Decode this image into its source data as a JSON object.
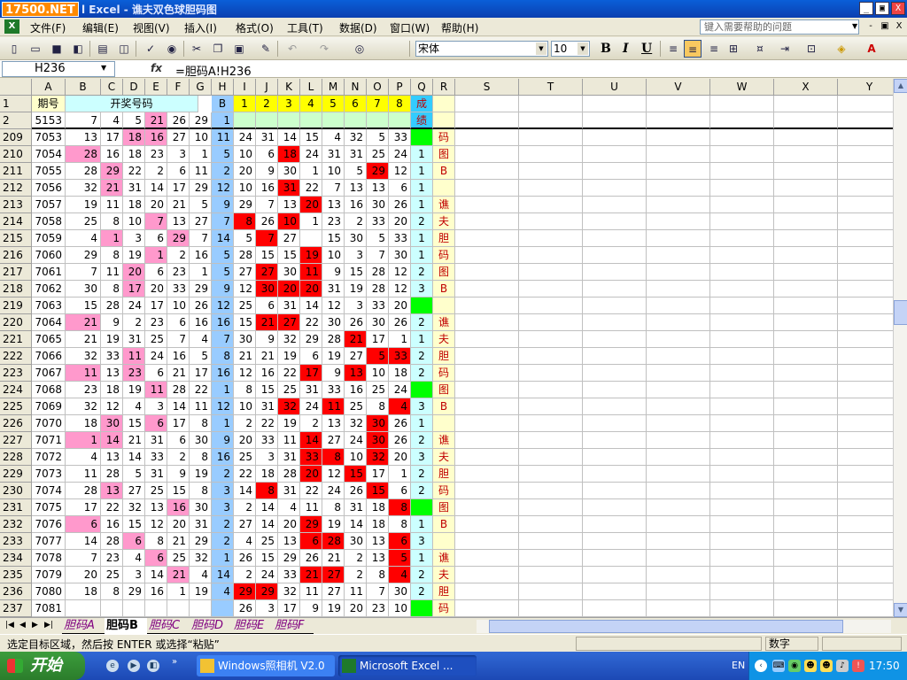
{
  "titlebar": {
    "logo": "17500.NET",
    "title": "l Excel - 谯夫双色球胆码图",
    "min": "_",
    "restore": "▣",
    "close": "X"
  },
  "menubar": {
    "items": [
      "文件(F)",
      "编辑(E)",
      "视图(V)",
      "插入(I)",
      "格式(O)",
      "工具(T)",
      "数据(D)",
      "窗口(W)",
      "帮助(H)"
    ],
    "help_placeholder": "键入需要帮助的问题",
    "doc_min": "-",
    "doc_restore": "▣",
    "doc_close": "X"
  },
  "toolbar": {
    "font": "宋体",
    "size": "10",
    "bold": "B",
    "italic": "I",
    "underline": "U"
  },
  "formula_bar": {
    "cell_ref": "H236",
    "fx": "fx",
    "formula": "=胆码A!H236"
  },
  "columns": [
    "A",
    "B",
    "C",
    "D",
    "E",
    "F",
    "G",
    "H",
    "I",
    "J",
    "K",
    "L",
    "M",
    "N",
    "O",
    "P",
    "Q",
    "R",
    "S",
    "T",
    "U",
    "V",
    "W",
    "X",
    "Y"
  ],
  "header_rows": {
    "row1": {
      "num": "1",
      "period": "期号",
      "draw": "开奖号码",
      "blue": "B",
      "pos": [
        "1",
        "2",
        "3",
        "4",
        "5",
        "6",
        "7",
        "8"
      ],
      "result": "成"
    },
    "row2": {
      "num": "2",
      "a": "5153",
      "b": "7",
      "c": "4",
      "d": "5",
      "e": "21",
      "f": "26",
      "g": "29",
      "h": "1",
      "result": "绩"
    }
  },
  "rows": [
    {
      "n": "209",
      "a": "7053",
      "d": [
        13,
        17,
        18,
        16,
        27,
        10
      ],
      "h": 11,
      "p": [
        24,
        31,
        14,
        15,
        4,
        32,
        5,
        33
      ],
      "q": "",
      "r": "码"
    },
    {
      "n": "210",
      "a": "7054",
      "d": [
        28,
        16,
        18,
        23,
        3,
        1
      ],
      "h": 5,
      "p": [
        10,
        6,
        18,
        24,
        31,
        31,
        25,
        24
      ],
      "q": "1",
      "r": "图"
    },
    {
      "n": "211",
      "a": "7055",
      "d": [
        28,
        29,
        22,
        2,
        6,
        11
      ],
      "h": 2,
      "p": [
        20,
        9,
        30,
        1,
        10,
        5,
        29,
        12
      ],
      "q": "1",
      "r": "B"
    },
    {
      "n": "212",
      "a": "7056",
      "d": [
        32,
        21,
        31,
        14,
        17,
        29
      ],
      "h": 12,
      "p": [
        10,
        16,
        31,
        22,
        7,
        13,
        13,
        6
      ],
      "q": "1",
      "r": ""
    },
    {
      "n": "213",
      "a": "7057",
      "d": [
        19,
        11,
        18,
        20,
        21,
        5
      ],
      "h": 9,
      "p": [
        29,
        7,
        13,
        20,
        13,
        16,
        30,
        26
      ],
      "q": "1",
      "r": "谯"
    },
    {
      "n": "214",
      "a": "7058",
      "d": [
        25,
        8,
        10,
        7,
        13,
        27
      ],
      "h": 7,
      "p": [
        8,
        26,
        10,
        1,
        23,
        2,
        33,
        20
      ],
      "q": "2",
      "r": "夫"
    },
    {
      "n": "215",
      "a": "7059",
      "d": [
        4,
        1,
        3,
        6,
        29,
        7
      ],
      "h": 14,
      "p": [
        5,
        7,
        27,
        "",
        15,
        30,
        5,
        33
      ],
      "q": "1",
      "r": "胆"
    },
    {
      "n": "216",
      "a": "7060",
      "d": [
        29,
        8,
        19,
        1,
        2,
        16
      ],
      "h": 5,
      "p": [
        28,
        15,
        15,
        19,
        10,
        3,
        7,
        30
      ],
      "q": "1",
      "r": "码"
    },
    {
      "n": "217",
      "a": "7061",
      "d": [
        7,
        11,
        20,
        6,
        23,
        1
      ],
      "h": 5,
      "p": [
        27,
        27,
        30,
        11,
        9,
        15,
        28,
        12
      ],
      "q": "2",
      "r": "图"
    },
    {
      "n": "218",
      "a": "7062",
      "d": [
        30,
        8,
        17,
        20,
        33,
        29
      ],
      "h": 9,
      "p": [
        12,
        30,
        20,
        20,
        31,
        19,
        28,
        12
      ],
      "q": "3",
      "r": "B"
    },
    {
      "n": "219",
      "a": "7063",
      "d": [
        15,
        28,
        24,
        17,
        10,
        26
      ],
      "h": 12,
      "p": [
        25,
        6,
        31,
        14,
        12,
        3,
        33,
        20
      ],
      "q": "",
      "r": ""
    },
    {
      "n": "220",
      "a": "7064",
      "d": [
        21,
        9,
        2,
        23,
        6,
        16
      ],
      "h": 16,
      "p": [
        15,
        21,
        27,
        22,
        30,
        26,
        30,
        26
      ],
      "q": "2",
      "r": "谯"
    },
    {
      "n": "221",
      "a": "7065",
      "d": [
        21,
        19,
        31,
        25,
        7,
        4
      ],
      "h": 7,
      "p": [
        30,
        9,
        32,
        29,
        28,
        21,
        17,
        1
      ],
      "q": "1",
      "r": "夫"
    },
    {
      "n": "222",
      "a": "7066",
      "d": [
        32,
        33,
        11,
        24,
        16,
        5
      ],
      "h": 8,
      "p": [
        21,
        21,
        19,
        6,
        19,
        27,
        5,
        33
      ],
      "q": "2",
      "r": "胆"
    },
    {
      "n": "223",
      "a": "7067",
      "d": [
        11,
        13,
        23,
        6,
        21,
        17
      ],
      "h": 16,
      "p": [
        12,
        16,
        22,
        17,
        9,
        13,
        10,
        18
      ],
      "q": "2",
      "r": "码"
    },
    {
      "n": "224",
      "a": "7068",
      "d": [
        23,
        18,
        19,
        11,
        28,
        22
      ],
      "h": 1,
      "p": [
        8,
        15,
        25,
        31,
        33,
        16,
        25,
        24
      ],
      "q": "",
      "r": "图"
    },
    {
      "n": "225",
      "a": "7069",
      "d": [
        32,
        12,
        4,
        3,
        14,
        11
      ],
      "h": 12,
      "p": [
        10,
        31,
        32,
        24,
        11,
        25,
        8,
        4
      ],
      "q": "3",
      "r": "B"
    },
    {
      "n": "226",
      "a": "7070",
      "d": [
        18,
        30,
        15,
        6,
        17,
        8
      ],
      "h": 1,
      "p": [
        2,
        22,
        19,
        2,
        13,
        32,
        30,
        26
      ],
      "q": "1",
      "r": ""
    },
    {
      "n": "227",
      "a": "7071",
      "d": [
        1,
        14,
        21,
        31,
        6,
        30
      ],
      "h": 9,
      "p": [
        20,
        33,
        11,
        14,
        27,
        24,
        30,
        26
      ],
      "q": "2",
      "r": "谯"
    },
    {
      "n": "228",
      "a": "7072",
      "d": [
        4,
        13,
        14,
        33,
        2,
        8
      ],
      "h": 16,
      "p": [
        25,
        3,
        31,
        33,
        8,
        10,
        32,
        20
      ],
      "q": "3",
      "r": "夫"
    },
    {
      "n": "229",
      "a": "7073",
      "d": [
        11,
        28,
        5,
        31,
        9,
        19
      ],
      "h": 2,
      "p": [
        22,
        18,
        28,
        20,
        12,
        15,
        17,
        1
      ],
      "q": "2",
      "r": "胆"
    },
    {
      "n": "230",
      "a": "7074",
      "d": [
        28,
        13,
        27,
        25,
        15,
        8
      ],
      "h": 3,
      "p": [
        14,
        8,
        31,
        22,
        24,
        26,
        15,
        6
      ],
      "q": "2",
      "r": "码"
    },
    {
      "n": "231",
      "a": "7075",
      "d": [
        17,
        22,
        32,
        13,
        16,
        30
      ],
      "h": 3,
      "p": [
        2,
        14,
        4,
        11,
        8,
        31,
        18,
        8
      ],
      "q": "",
      "r": "图"
    },
    {
      "n": "232",
      "a": "7076",
      "d": [
        6,
        16,
        15,
        12,
        20,
        31
      ],
      "h": 2,
      "p": [
        27,
        14,
        20,
        29,
        19,
        14,
        18,
        8
      ],
      "q": "1",
      "r": "B"
    },
    {
      "n": "233",
      "a": "7077",
      "d": [
        14,
        28,
        6,
        8,
        21,
        29
      ],
      "h": 2,
      "p": [
        4,
        25,
        13,
        6,
        28,
        30,
        13,
        6
      ],
      "q": "3",
      "r": ""
    },
    {
      "n": "234",
      "a": "7078",
      "d": [
        7,
        23,
        4,
        6,
        25,
        32
      ],
      "h": 1,
      "p": [
        26,
        15,
        29,
        26,
        21,
        2,
        13,
        5
      ],
      "q": "1",
      "r": "谯"
    },
    {
      "n": "235",
      "a": "7079",
      "d": [
        20,
        25,
        3,
        14,
        21,
        4
      ],
      "h": 14,
      "p": [
        2,
        24,
        33,
        21,
        27,
        2,
        8,
        4
      ],
      "q": "2",
      "r": "夫"
    },
    {
      "n": "236",
      "a": "7080",
      "d": [
        18,
        8,
        29,
        16,
        1,
        19
      ],
      "h": 4,
      "p": [
        29,
        29,
        32,
        11,
        27,
        11,
        7,
        30
      ],
      "q": "2",
      "r": "胆"
    },
    {
      "n": "237",
      "a": "7081",
      "d": [
        "",
        "",
        "",
        "",
        "",
        ""
      ],
      "h": "",
      "p": [
        26,
        3,
        17,
        9,
        19,
        20,
        23,
        10
      ],
      "q": "",
      "r": "码"
    }
  ],
  "pink_cells": [
    [
      0,
      2
    ],
    [
      0,
      3
    ],
    [
      1,
      0
    ],
    [
      2,
      1
    ],
    [
      3,
      1
    ],
    [
      5,
      3
    ],
    [
      6,
      1
    ],
    [
      6,
      4
    ],
    [
      7,
      3
    ],
    [
      8,
      2
    ],
    [
      9,
      2
    ],
    [
      11,
      0
    ],
    [
      13,
      2
    ],
    [
      14,
      0
    ],
    [
      14,
      2
    ],
    [
      15,
      3
    ],
    [
      17,
      1
    ],
    [
      17,
      3
    ],
    [
      18,
      0
    ],
    [
      18,
      1
    ],
    [
      21,
      1
    ],
    [
      22,
      4
    ],
    [
      23,
      0
    ],
    [
      24,
      2
    ],
    [
      25,
      3
    ],
    [
      26,
      4
    ]
  ],
  "red_cells": [
    [
      1,
      2
    ],
    [
      2,
      6
    ],
    [
      3,
      2
    ],
    [
      4,
      3
    ],
    [
      5,
      0
    ],
    [
      5,
      2
    ],
    [
      6,
      1
    ],
    [
      7,
      3
    ],
    [
      8,
      1
    ],
    [
      8,
      3
    ],
    [
      9,
      1
    ],
    [
      9,
      2
    ],
    [
      9,
      3
    ],
    [
      11,
      1
    ],
    [
      11,
      2
    ],
    [
      12,
      5
    ],
    [
      13,
      6
    ],
    [
      13,
      7
    ],
    [
      14,
      3
    ],
    [
      14,
      5
    ],
    [
      16,
      2
    ],
    [
      16,
      4
    ],
    [
      16,
      7
    ],
    [
      17,
      6
    ],
    [
      18,
      3
    ],
    [
      18,
      6
    ],
    [
      19,
      3
    ],
    [
      19,
      4
    ],
    [
      19,
      6
    ],
    [
      20,
      3
    ],
    [
      20,
      5
    ],
    [
      21,
      1
    ],
    [
      21,
      6
    ],
    [
      22,
      7
    ],
    [
      23,
      3
    ],
    [
      24,
      3
    ],
    [
      24,
      4
    ],
    [
      24,
      7
    ],
    [
      25,
      7
    ],
    [
      26,
      3
    ],
    [
      26,
      4
    ],
    [
      26,
      7
    ],
    [
      27,
      0
    ],
    [
      27,
      1
    ]
  ],
  "sheet_tabs": [
    "胆码A",
    "胆码B",
    "胆码C",
    "胆码D",
    "胆码E",
    "胆码F"
  ],
  "statusbar": {
    "text": "选定目标区域，然后按 ENTER 或选择“粘贴”",
    "mode": "数字"
  },
  "taskbar": {
    "start": "开始",
    "items": [
      "Windows照相机 V2.0",
      "Microsoft Excel ..."
    ],
    "lang": "EN",
    "clock": "17:50"
  },
  "colors": {
    "pink": "#ff99cc",
    "red": "#ff0000",
    "blue_col": "#99ccff",
    "yellow": "#ffff00",
    "light_yellow": "#ffffcc",
    "green": "#00ff00",
    "cyan": "#ccffff",
    "light_green": "#ccffcc",
    "r_text": "#c00000"
  }
}
